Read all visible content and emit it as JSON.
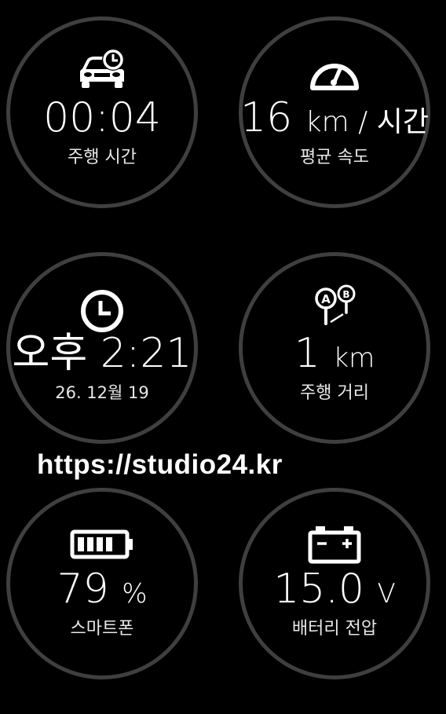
{
  "gauges": {
    "drive_time": {
      "icon": "car-clock-icon",
      "value": "00:04",
      "label": "주행 시간"
    },
    "avg_speed": {
      "icon": "speedometer-icon",
      "value": "16",
      "unit": "km / 시간",
      "label": "평균 속도"
    },
    "clock": {
      "icon": "clock-icon",
      "value": "오후 2:21",
      "label": "26. 12월 19"
    },
    "distance": {
      "icon": "route-ab-icon",
      "value": "1",
      "unit": "km",
      "label": "주행 거리"
    },
    "phone_battery": {
      "icon": "battery-icon",
      "value": "79",
      "unit": "%",
      "label": "스마트폰",
      "level_percent": 79
    },
    "car_battery": {
      "icon": "car-battery-icon",
      "value": "15.0",
      "unit": "V",
      "label": "배터리 전압"
    }
  },
  "watermark": "https://studio24.kr",
  "colors": {
    "background": "#000000",
    "ring": "#3f3f3f",
    "text": "#ffffff"
  }
}
